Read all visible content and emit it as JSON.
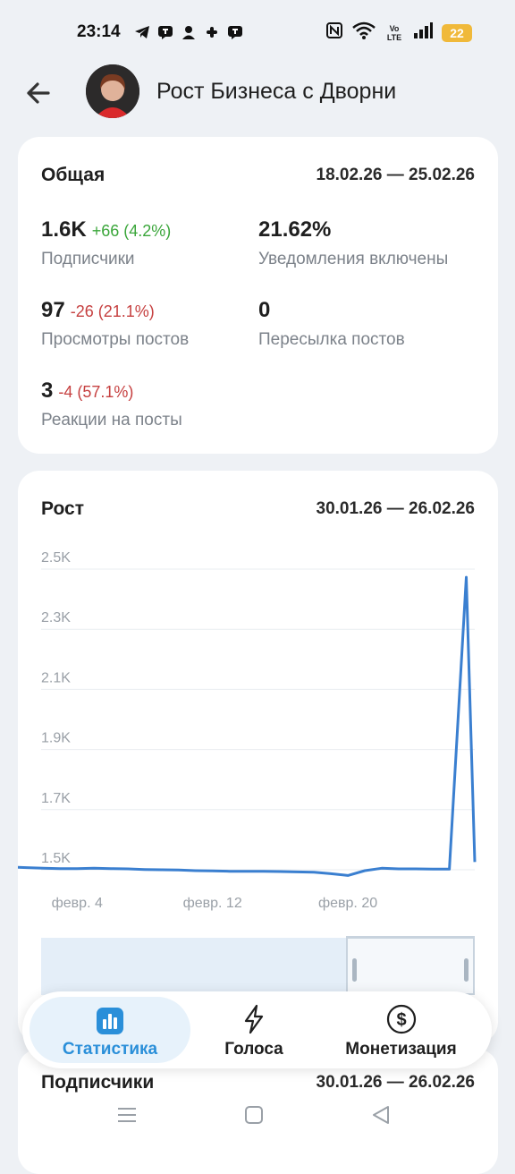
{
  "status_bar": {
    "time": "23:14",
    "battery": "22",
    "icons_left": [
      "telegram-icon",
      "chat-icon",
      "person-icon",
      "slack-icon",
      "chat-icon"
    ],
    "icons_right": [
      "nfc-icon",
      "wifi-icon",
      "volte-icon",
      "signal-icon",
      "battery-icon"
    ],
    "volte_top": "Vo",
    "volte_bottom": "LTE"
  },
  "header": {
    "title": "Рост Бизнеса с Дворни"
  },
  "overview": {
    "title": "Общая",
    "range": "18.02.26 — 25.02.26",
    "stats": [
      {
        "value": "1.6K",
        "delta": "+66 (4.2%)",
        "delta_type": "positive",
        "label": "Подписчики"
      },
      {
        "value": "21.62%",
        "delta": "",
        "label": "Уведомления включены"
      },
      {
        "value": "97",
        "delta": "-26 (21.1%)",
        "delta_type": "negative",
        "label": "Просмотры постов"
      },
      {
        "value": "0",
        "delta": "",
        "label": "Пересылка постов"
      },
      {
        "value": "3",
        "delta": "-4 (57.1%)",
        "delta_type": "negative",
        "label": "Реакции на посты"
      }
    ]
  },
  "growth": {
    "title": "Рост",
    "range": "30.01.26 — 26.02.26"
  },
  "chart_data": {
    "type": "line",
    "ylabels": [
      "2.5K",
      "2.3K",
      "2.1K",
      "1.9K",
      "1.7K",
      "1.5K"
    ],
    "yticks": [
      2500,
      2300,
      2100,
      1900,
      1700,
      1500
    ],
    "xlabels": [
      "февр. 4",
      "февр. 12",
      "февр. 20"
    ],
    "x_label_days": [
      4,
      12,
      20
    ],
    "ylim": [
      1500,
      2500
    ],
    "series": [
      {
        "color": "#3a7fd0",
        "x": [
          0.5,
          1,
          2,
          3,
          4,
          5,
          6,
          7,
          8,
          9,
          10,
          11,
          12,
          13,
          14,
          15,
          16,
          17,
          18,
          19,
          20,
          21,
          22,
          23,
          24,
          25,
          26,
          27,
          27.5
        ],
        "values": [
          1508,
          1507,
          1505,
          1504,
          1504,
          1505,
          1504,
          1503,
          1501,
          1500,
          1499,
          1497,
          1496,
          1495,
          1495,
          1495,
          1494,
          1493,
          1492,
          1487,
          1481,
          1497,
          1505,
          1503,
          1503,
          1502,
          1502,
          2473,
          1526
        ]
      }
    ]
  },
  "subscribers_card": {
    "title": "Подписчики",
    "range": "30.01.26 — 26.02.26"
  },
  "bottom_nav": {
    "items": [
      {
        "label": "Статистика",
        "icon": "bar-chart-icon",
        "active": true
      },
      {
        "label": "Голоса",
        "icon": "lightning-icon",
        "active": false
      },
      {
        "label": "Монетизация",
        "icon": "dollar-icon",
        "active": false
      }
    ]
  },
  "colors": {
    "accent": "#2a8fd9",
    "positive": "#3aa63a",
    "negative": "#c64040",
    "line": "#3a7fd0"
  }
}
